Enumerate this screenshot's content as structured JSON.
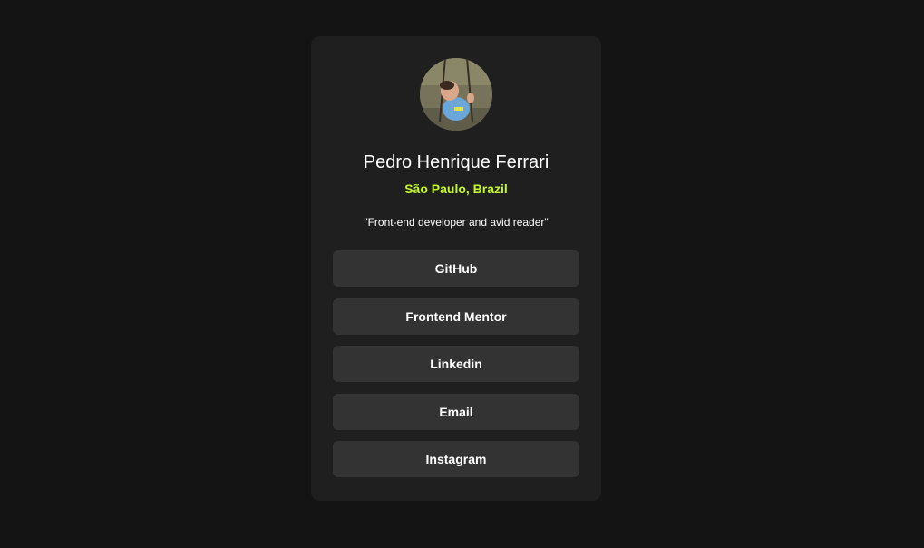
{
  "profile": {
    "name": "Pedro Henrique Ferrari",
    "location": "São Paulo, Brazil",
    "bio": "\"Front-end developer and avid reader\""
  },
  "links": [
    {
      "label": "GitHub"
    },
    {
      "label": "Frontend Mentor"
    },
    {
      "label": "Linkedin"
    },
    {
      "label": "Email"
    },
    {
      "label": "Instagram"
    }
  ],
  "colors": {
    "page_background": "#141414",
    "card_background": "#1f1f1f",
    "button_background": "#333333",
    "accent": "#c4f82a",
    "text": "#ffffff"
  }
}
